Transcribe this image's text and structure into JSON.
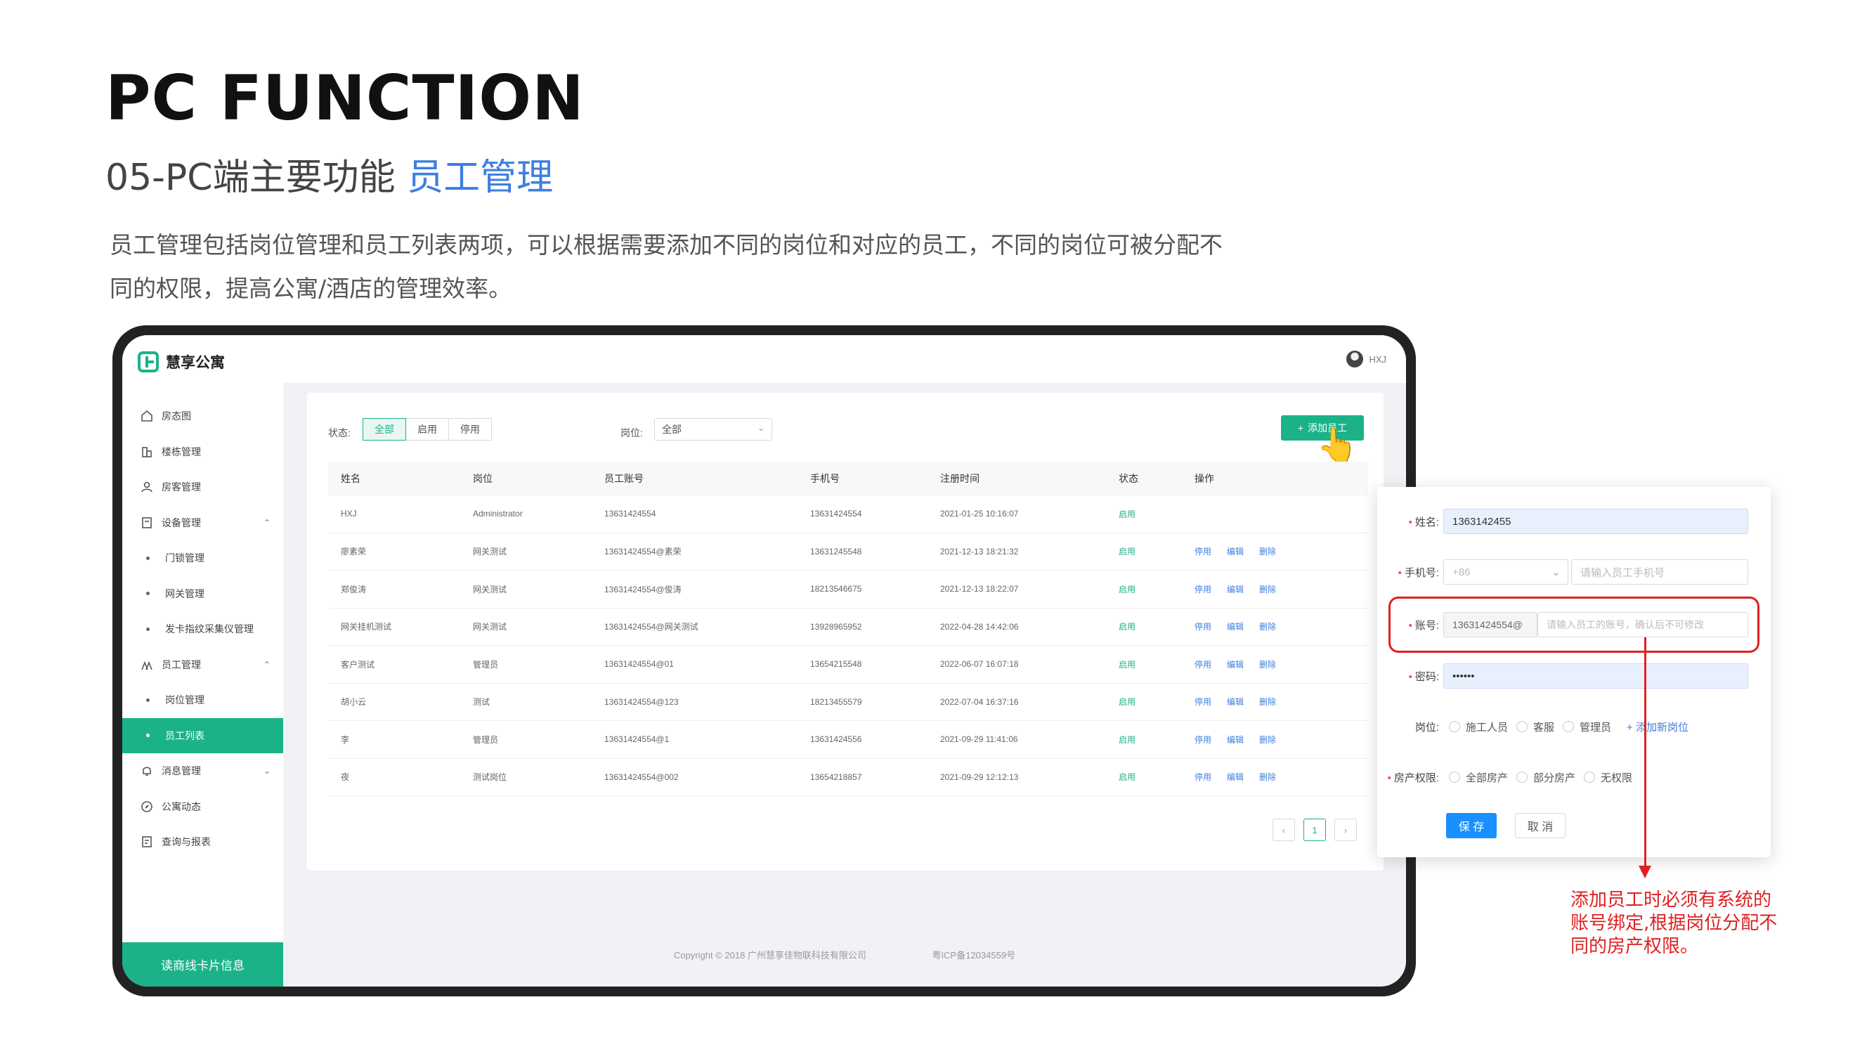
{
  "slide": {
    "title": "PC FUNCTION",
    "subtitle_prefix": "05-PC端主要功能",
    "subtitle_accent": "员工管理",
    "description": "员工管理包括岗位管理和员工列表两项，可以根据需要添加不同的岗位和对应的员工，不同的岗位可被分配不同的权限，提高公寓/酒店的管理效率。",
    "annotation": "添加员工时必须有系统的账号绑定,根据岗位分配不同的房产权限。",
    "colors": {
      "accent_blue": "#3d7fe0",
      "brand_green": "#1bb28a",
      "annotation_red": "#e02020"
    }
  },
  "app": {
    "name": "慧享公寓",
    "user": "HXJ",
    "sidebar": {
      "items": [
        {
          "label": "房态图",
          "icon": "home-icon"
        },
        {
          "label": "楼栋管理",
          "icon": "building-icon"
        },
        {
          "label": "房客管理",
          "icon": "user-icon"
        },
        {
          "label": "设备管理",
          "icon": "device-icon",
          "expanded": true
        },
        {
          "label": "门锁管理",
          "sub": true
        },
        {
          "label": "网关管理",
          "sub": true
        },
        {
          "label": "发卡指纹采集仪管理",
          "sub": true
        },
        {
          "label": "员工管理",
          "icon": "staff-icon",
          "expanded": true
        },
        {
          "label": "岗位管理",
          "sub": true
        },
        {
          "label": "员工列表",
          "sub": true,
          "active": true
        },
        {
          "label": "消息管理",
          "icon": "bell-icon",
          "expanded": false
        },
        {
          "label": "公寓动态",
          "icon": "compass-icon"
        },
        {
          "label": "查询与报表",
          "icon": "report-icon"
        }
      ],
      "footer": "读商线卡片信息",
      "caret_up": "⌃",
      "caret_down": "⌄"
    },
    "filters": {
      "status_label": "状态:",
      "status_options": [
        "全部",
        "启用",
        "停用"
      ],
      "status_selected": "全部",
      "post_label": "岗位:",
      "post_value": "全部",
      "add_button": "添加员工",
      "add_icon": "+"
    },
    "table": {
      "headers": [
        "姓名",
        "岗位",
        "员工账号",
        "手机号",
        "注册时间",
        "状态",
        "操作"
      ],
      "rows": [
        {
          "name": "HXJ",
          "post": "Administrator",
          "account": "13631424554",
          "phone": "13631424554",
          "time": "2021-01-25 10:16:07",
          "status": "启用",
          "actions": []
        },
        {
          "name": "廖素荣",
          "post": "网关测试",
          "account": "13631424554@素荣",
          "phone": "13631245548",
          "time": "2021-12-13 18:21:32",
          "status": "启用",
          "actions": [
            "停用",
            "编辑",
            "删除"
          ]
        },
        {
          "name": "郑俊涛",
          "post": "网关测试",
          "account": "13631424554@俊涛",
          "phone": "18213546675",
          "time": "2021-12-13 18:22:07",
          "status": "启用",
          "actions": [
            "停用",
            "编辑",
            "删除"
          ]
        },
        {
          "name": "网关挂机测试",
          "post": "网关测试",
          "account": "13631424554@网关测试",
          "phone": "13928965952",
          "time": "2022-04-28 14:42:06",
          "status": "启用",
          "actions": [
            "停用",
            "编辑",
            "删除"
          ]
        },
        {
          "name": "客户测试",
          "post": "管理员",
          "account": "13631424554@01",
          "phone": "13654215548",
          "time": "2022-06-07 16:07:18",
          "status": "启用",
          "actions": [
            "停用",
            "编辑",
            "删除"
          ]
        },
        {
          "name": "胡小云",
          "post": "测试",
          "account": "13631424554@123",
          "phone": "18213455579",
          "time": "2022-07-04 16:37:16",
          "status": "启用",
          "actions": [
            "停用",
            "编辑",
            "删除"
          ]
        },
        {
          "name": "李",
          "post": "管理员",
          "account": "13631424554@1",
          "phone": "13631424556",
          "time": "2021-09-29 11:41:06",
          "status": "启用",
          "actions": [
            "停用",
            "编辑",
            "删除"
          ]
        },
        {
          "name": "夜",
          "post": "测试岗位",
          "account": "13631424554@002",
          "phone": "13654218857",
          "time": "2021-09-29 12:12:13",
          "status": "启用",
          "actions": [
            "停用",
            "编辑",
            "删除"
          ]
        }
      ]
    },
    "pagination": {
      "prev": "‹",
      "current": "1",
      "next": "›"
    },
    "copyright": "Copyright © 2018 广州慧享佳物联科技有限公司",
    "icp": "粤ICP备12034559号"
  },
  "form": {
    "name_label": "姓名:",
    "name_value": "1363142455",
    "phone_label": "手机号:",
    "phone_prefix": "+86",
    "phone_placeholder": "请输入员工手机号",
    "account_label": "账号:",
    "account_prefix": "13631424554@",
    "account_placeholder": "请输入员工的账号，确认后不可修改",
    "password_label": "密码:",
    "password_value": "••••••",
    "post_label": "岗位:",
    "post_options": [
      "施工人员",
      "客服",
      "管理员"
    ],
    "add_post": "+ 添加新岗位",
    "property_label": "房产权限:",
    "property_options": [
      "全部房产",
      "部分房产",
      "无权限"
    ],
    "save": "保 存",
    "cancel": "取 消"
  }
}
